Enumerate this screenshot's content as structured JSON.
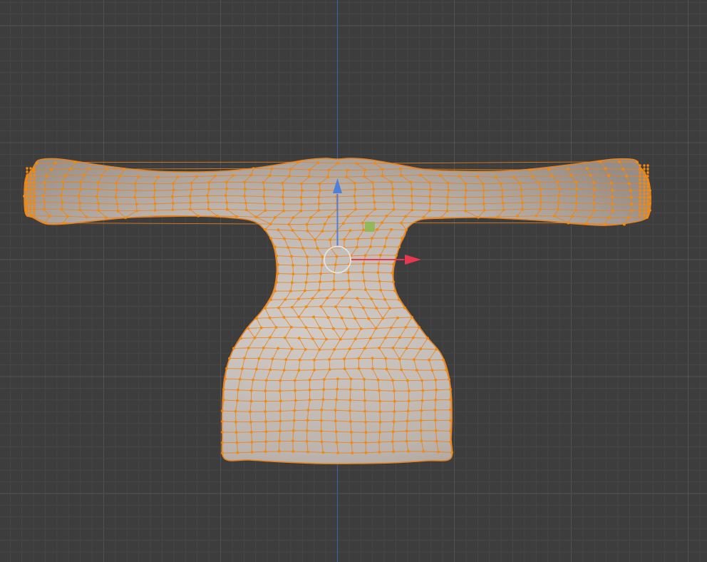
{
  "viewport": {
    "mode": "edit-mode",
    "view": "front-orthographic",
    "shading": "solid",
    "background_color": "#3d3d3d",
    "grid_minor_color": "#474747",
    "grid_major_color": "#525252",
    "z_axis_line_color": "#3d5d9d"
  },
  "mesh": {
    "object": "garment-mesh",
    "selection": "all-vertices-selected",
    "surface_color": "#bcb3ad",
    "wire_color": "#e8821c",
    "vertex_color": "#f5890a"
  },
  "gizmo": {
    "type": "move",
    "x_axis_color": "#e8384f",
    "z_axis_color": "#4f7fdb",
    "plane_handle_color": "#8db84a",
    "pivot_ring_color": "#e0e0e0"
  }
}
